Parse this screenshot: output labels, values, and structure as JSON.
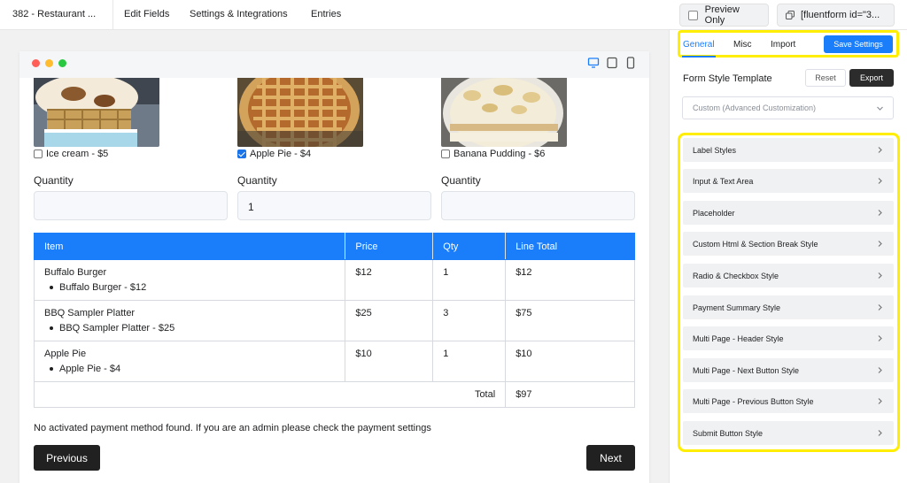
{
  "topbar": {
    "form_title": "382 - Restaurant ...",
    "nav": [
      "Edit Fields",
      "Settings & Integrations",
      "Entries"
    ],
    "preview_label": "Preview Only",
    "shortcode": "[fluentform id=\"3..."
  },
  "preview": {
    "devices": [
      "desktop-icon",
      "tablet-icon",
      "mobile-icon"
    ],
    "products": [
      {
        "label": "Ice cream - $5",
        "checked": false
      },
      {
        "label": "Apple Pie - $4",
        "checked": true
      },
      {
        "label": "Banana Pudding - $6",
        "checked": false
      }
    ],
    "quantity_label": "Quantity",
    "quantities": [
      "",
      "1",
      ""
    ],
    "table": {
      "headers": [
        "Item",
        "Price",
        "Qty",
        "Line Total"
      ],
      "rows": [
        {
          "item": "Buffalo Burger",
          "sub": "Buffalo Burger - $12",
          "price": "$12",
          "qty": "1",
          "total": "$12"
        },
        {
          "item": "BBQ Sampler Platter",
          "sub": "BBQ Sampler Platter - $25",
          "price": "$25",
          "qty": "3",
          "total": "$75"
        },
        {
          "item": "Apple Pie",
          "sub": "Apple Pie - $4",
          "price": "$10",
          "qty": "1",
          "total": "$10"
        }
      ],
      "total_label": "Total",
      "total_value": "$97"
    },
    "notice": "No activated payment method found. If you are an admin please check the payment settings",
    "prev_label": "Previous",
    "next_label": "Next"
  },
  "panel": {
    "tabs": [
      "General",
      "Misc",
      "Import"
    ],
    "save_label": "Save Settings",
    "template_label": "Form Style Template",
    "reset_label": "Reset",
    "export_label": "Export",
    "template_value": "Custom (Advanced Customization)",
    "sections": [
      "Label Styles",
      "Input & Text Area",
      "Placeholder",
      "Custom Html & Section Break Style",
      "Radio & Checkbox Style",
      "Payment Summary Style",
      "Multi Page - Header Style",
      "Multi Page - Next Button Style",
      "Multi Page - Previous Button Style",
      "Submit Button Style"
    ]
  },
  "colors": {
    "accent": "#1a7efb",
    "highlight": "#ffee00",
    "dark_button": "#212121"
  }
}
